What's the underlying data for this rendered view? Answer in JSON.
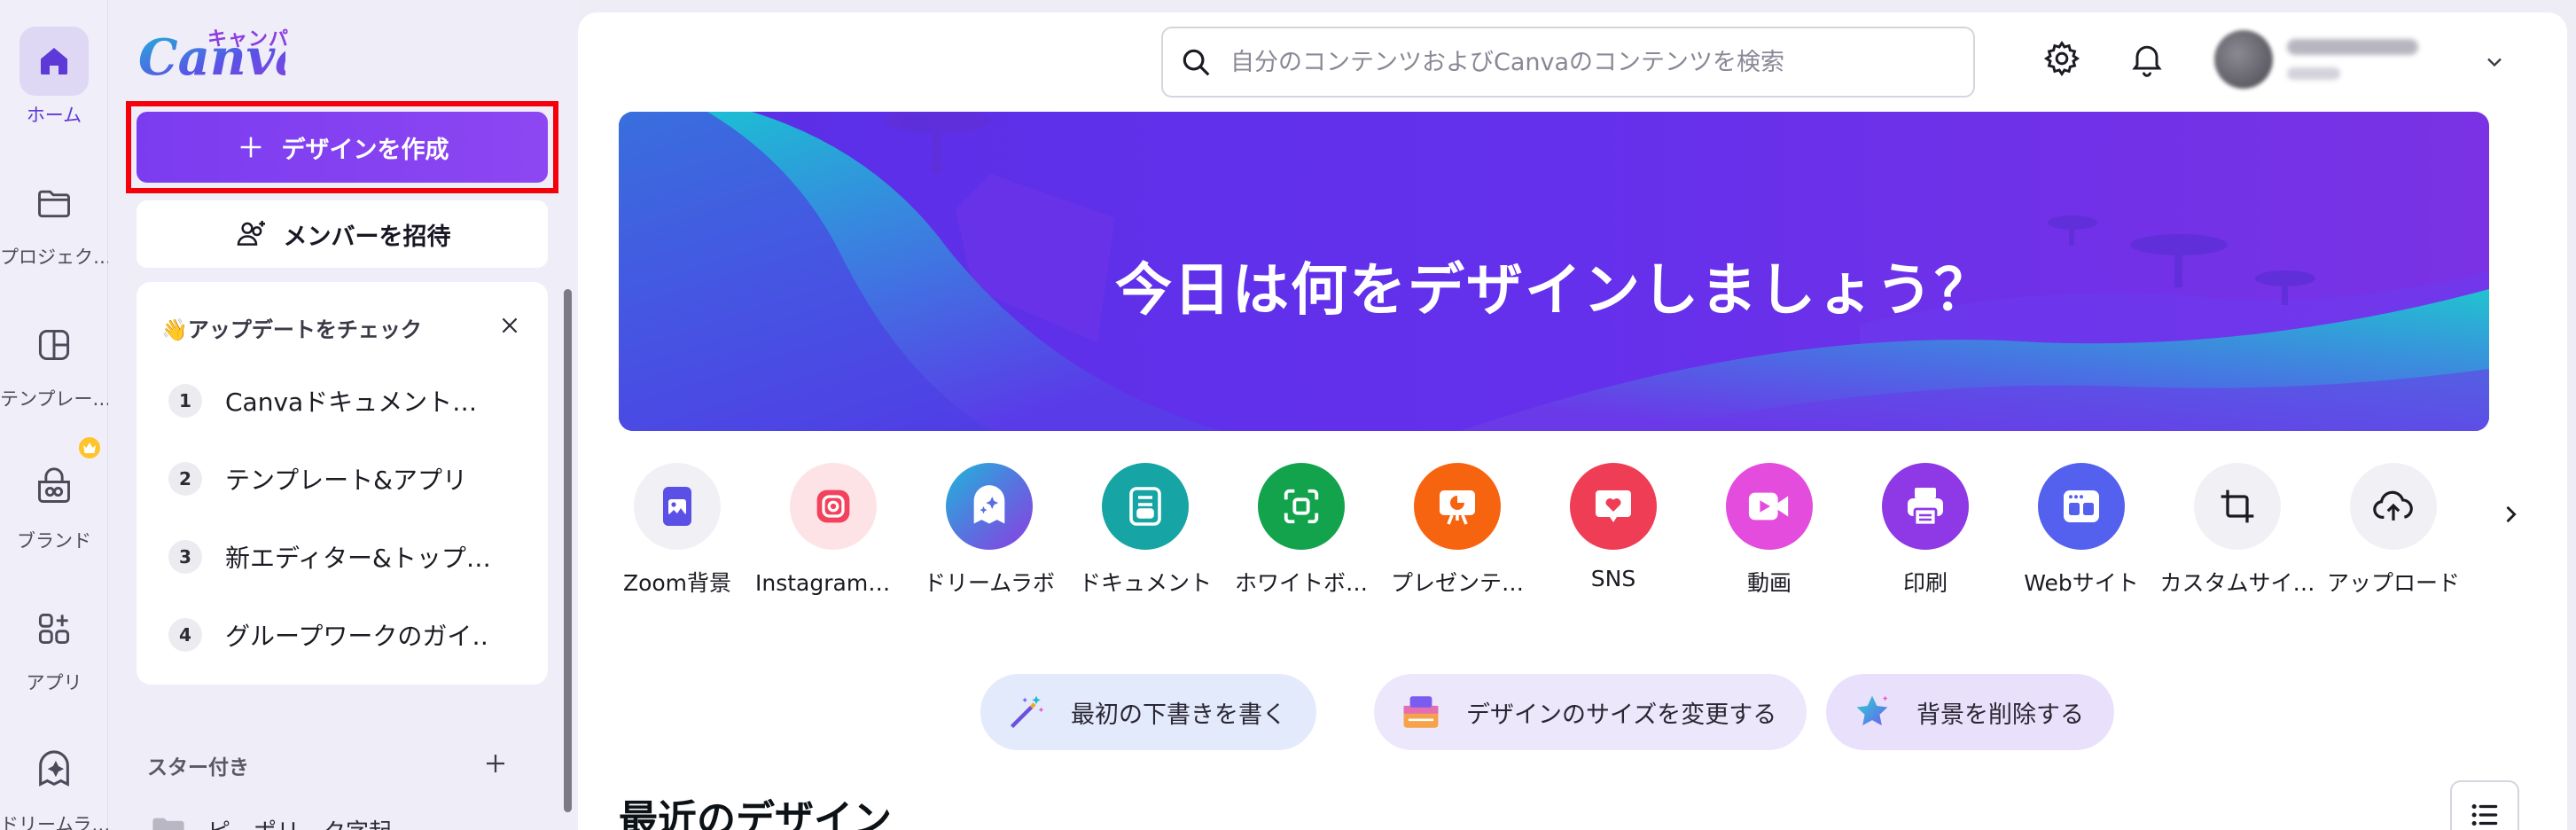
{
  "rail": {
    "items": [
      {
        "label": "ホーム",
        "icon": "home-icon",
        "active": true
      },
      {
        "label": "プロジェク…",
        "icon": "folder-icon"
      },
      {
        "label": "テンプレー…",
        "icon": "template-icon"
      },
      {
        "label": "ブランド",
        "icon": "brand-icon"
      },
      {
        "label": "アプリ",
        "icon": "apps-icon"
      },
      {
        "label": "ドリームラ…",
        "icon": "dream-lab-icon"
      }
    ]
  },
  "panel": {
    "logo_text": "Canva",
    "logo_kana": "キャンパ",
    "create_button": "デザインを作成",
    "invite_button": "メンバーを招待",
    "updates": {
      "title": "👋アップデートをチェック",
      "items": [
        {
          "num": "1",
          "label": "Canvaドキュメント…"
        },
        {
          "num": "2",
          "label": "テンプレート&アプリ"
        },
        {
          "num": "3",
          "label": "新エディター&トップ…"
        },
        {
          "num": "4",
          "label": "グループワークのガイ…"
        }
      ]
    },
    "starred_label": "スター付き",
    "folder_label": "ピ…ポリ…ク字起"
  },
  "header": {
    "search_placeholder": "自分のコンテンツおよびCanvaのコンテンツを検索"
  },
  "hero": {
    "title": "今日は何をデザインしましょう？"
  },
  "categories": [
    {
      "label": "Zoom背景",
      "color": "#f1f0f4",
      "icon": "zoom-background-icon"
    },
    {
      "label": "Instagram投…",
      "color": "#fde3e5",
      "icon": "instagram-icon"
    },
    {
      "label": "ドリームラボ",
      "color": "#5b6fe0",
      "icon": "dream-lab-icon"
    },
    {
      "label": "ドキュメント",
      "color": "#16a4a4",
      "icon": "document-icon"
    },
    {
      "label": "ホワイトボ…",
      "color": "#13a34d",
      "icon": "whiteboard-icon"
    },
    {
      "label": "プレゼンテ…",
      "color": "#f76410",
      "icon": "presentation-icon"
    },
    {
      "label": "SNS",
      "color": "#ef3d55",
      "icon": "sns-heart-icon"
    },
    {
      "label": "動画",
      "color": "#e34cdd",
      "icon": "video-icon"
    },
    {
      "label": "印刷",
      "color": "#8e38e6",
      "icon": "print-icon"
    },
    {
      "label": "Webサイト",
      "color": "#5361ee",
      "icon": "website-icon"
    },
    {
      "label": "カスタムサイ…",
      "color": "#f1f0f4",
      "icon": "custom-size-icon"
    },
    {
      "label": "アップロード",
      "color": "#f1f0f4",
      "icon": "upload-icon"
    }
  ],
  "quick_actions": [
    {
      "label": "最初の下書きを書く",
      "color": "#e3eafb",
      "icon": "magic-wand-icon"
    },
    {
      "label": "デザインのサイズを変更する",
      "color": "#ece7fb",
      "icon": "resize-icon"
    },
    {
      "label": "背景を削除する",
      "color": "#e9e1fb",
      "icon": "star-remove-bg-icon"
    }
  ],
  "recent": {
    "title": "最近のデザイン"
  },
  "colors": {
    "brand_purple": "#7d3cf0",
    "highlight_red": "#f5000a"
  }
}
